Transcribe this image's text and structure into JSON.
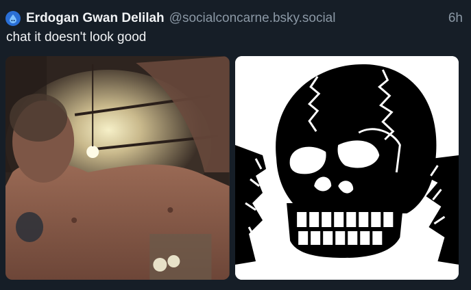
{
  "post": {
    "author_name": "Erdogan Gwan Delilah",
    "handle": "@socialconcarne.bsky.social",
    "timestamp": "6h",
    "text": "chat it doesn't look good"
  },
  "avatar": {
    "icon": "water-drop-icon",
    "color": "#2a6fd6"
  },
  "media": {
    "count": 2
  },
  "colors": {
    "background": "#161e27",
    "text_primary": "#f1f3f5",
    "text_secondary": "#8b98a5"
  }
}
